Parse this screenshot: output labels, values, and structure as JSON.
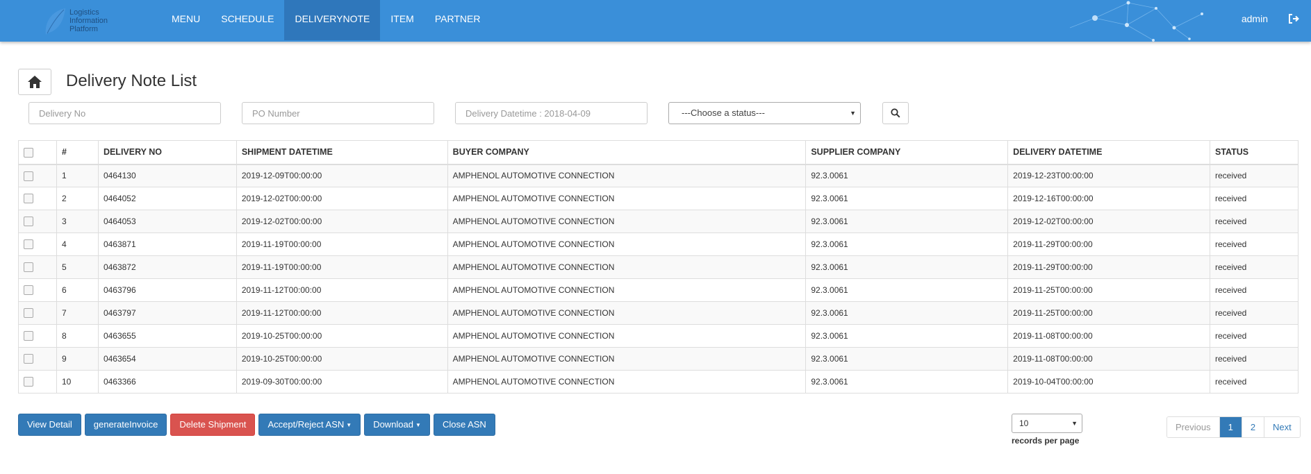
{
  "brand": {
    "lines": [
      "Logistics",
      "Information",
      "Platform"
    ]
  },
  "nav": {
    "items": [
      "MENU",
      "SCHEDULE",
      "DELIVERYNOTE",
      "ITEM",
      "PARTNER"
    ],
    "active": "DELIVERYNOTE",
    "user": "admin"
  },
  "page": {
    "title": "Delivery Note List"
  },
  "filters": {
    "delivery_no_placeholder": "Delivery No",
    "po_number_placeholder": "PO Number",
    "delivery_datetime_placeholder": "Delivery Datetime : 2018-04-09",
    "status_value": "---Choose a status---"
  },
  "table": {
    "headers": [
      "#",
      "DELIVERY NO",
      "SHIPMENT DATETIME",
      "BUYER COMPANY",
      "SUPPLIER COMPANY",
      "DELIVERY DATETIME",
      "STATUS"
    ],
    "rows": [
      [
        "1",
        "0464130",
        "2019-12-09T00:00:00",
        "AMPHENOL AUTOMOTIVE CONNECTION",
        "92.3.0061",
        "2019-12-23T00:00:00",
        "received"
      ],
      [
        "2",
        "0464052",
        "2019-12-02T00:00:00",
        "AMPHENOL AUTOMOTIVE CONNECTION",
        "92.3.0061",
        "2019-12-16T00:00:00",
        "received"
      ],
      [
        "3",
        "0464053",
        "2019-12-02T00:00:00",
        "AMPHENOL AUTOMOTIVE CONNECTION",
        "92.3.0061",
        "2019-12-02T00:00:00",
        "received"
      ],
      [
        "4",
        "0463871",
        "2019-11-19T00:00:00",
        "AMPHENOL AUTOMOTIVE CONNECTION",
        "92.3.0061",
        "2019-11-29T00:00:00",
        "received"
      ],
      [
        "5",
        "0463872",
        "2019-11-19T00:00:00",
        "AMPHENOL AUTOMOTIVE CONNECTION",
        "92.3.0061",
        "2019-11-29T00:00:00",
        "received"
      ],
      [
        "6",
        "0463796",
        "2019-11-12T00:00:00",
        "AMPHENOL AUTOMOTIVE CONNECTION",
        "92.3.0061",
        "2019-11-25T00:00:00",
        "received"
      ],
      [
        "7",
        "0463797",
        "2019-11-12T00:00:00",
        "AMPHENOL AUTOMOTIVE CONNECTION",
        "92.3.0061",
        "2019-11-25T00:00:00",
        "received"
      ],
      [
        "8",
        "0463655",
        "2019-10-25T00:00:00",
        "AMPHENOL AUTOMOTIVE CONNECTION",
        "92.3.0061",
        "2019-11-08T00:00:00",
        "received"
      ],
      [
        "9",
        "0463654",
        "2019-10-25T00:00:00",
        "AMPHENOL AUTOMOTIVE CONNECTION",
        "92.3.0061",
        "2019-11-08T00:00:00",
        "received"
      ],
      [
        "10",
        "0463366",
        "2019-09-30T00:00:00",
        "AMPHENOL AUTOMOTIVE CONNECTION",
        "92.3.0061",
        "2019-10-04T00:00:00",
        "received"
      ]
    ]
  },
  "actions": {
    "view_detail": "View Detail",
    "generate_invoice": "generateInvoice",
    "delete_shipment": "Delete Shipment",
    "accept_reject": "Accept/Reject ASN",
    "download": "Download",
    "close_asn": "Close ASN"
  },
  "paging": {
    "records_per_page_value": "10",
    "records_per_page_label": "records per page",
    "previous": "Previous",
    "pages": [
      "1",
      "2"
    ],
    "current": "1",
    "next": "Next"
  },
  "colors": {
    "navbar": "#3a8fd9",
    "primary": "#337ab7",
    "danger": "#d9534f"
  },
  "icons": {
    "home": "home-icon",
    "search": "search-icon",
    "logout": "logout-icon",
    "logo": "leaf-logo-icon"
  }
}
